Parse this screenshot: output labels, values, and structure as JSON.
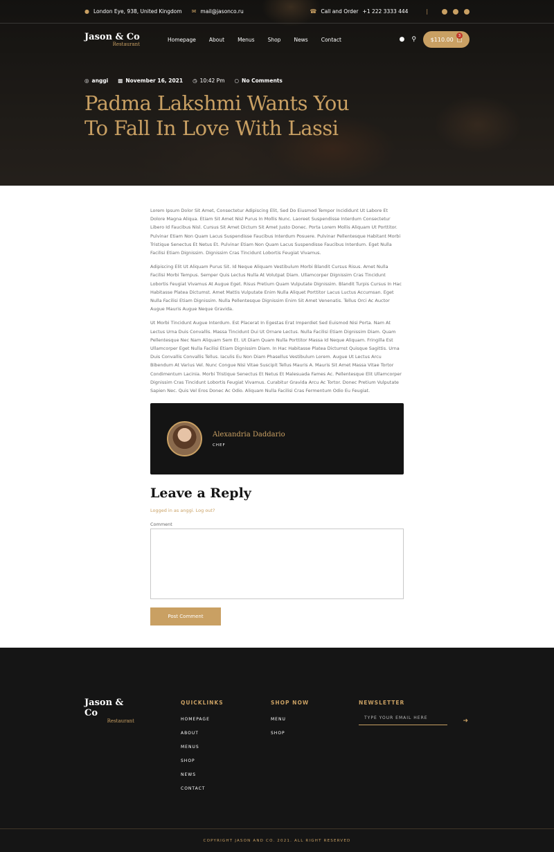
{
  "topbar": {
    "address": "London Eye, 938, United Kingdom",
    "email": "mail@jasonco.ru",
    "call_label": "Call and Order",
    "phone": "+1 222 3333 444"
  },
  "brand": {
    "name": "Jason & Co",
    "tagline": "Restaurant"
  },
  "nav": {
    "items": [
      "Homepage",
      "About",
      "Menus",
      "Shop",
      "News",
      "Contact"
    ]
  },
  "cart": {
    "total": "$110.00",
    "count": "3"
  },
  "post": {
    "author": "anggi",
    "date": "November 16, 2021",
    "time": "10:42 Pm",
    "comments": "No Comments",
    "title": "Padma Lakshmi Wants You To Fall In Love With Lassi",
    "paragraphs": [
      "Lorem Ipsum Dolor Sit Amet, Consectetur Adipiscing Elit, Sed Do Eiusmod Tempor Incididunt Ut Labore Et Dolore Magna Aliqua. Etiam Sit Amet Nisl Purus In Mollis Nunc. Laoreet Suspendisse Interdum Consectetur Libero Id Faucibus Nisl. Cursus Sit Amet Dictum Sit Amet Justo Donec. Porta Lorem Mollis Aliquam Ut Porttitor. Pulvinar Etiam Non Quam Lacus Suspendisse Faucibus Interdum Posuere. Pulvinar Pellentesque Habitant Morbi Tristique Senectus Et Netus Et. Pulvinar Etiam Non Quam Lacus Suspendisse Faucibus Interdum. Eget Nulla Facilisi Etiam Dignissim. Dignissim Cras Tincidunt Lobortis Feugiat Vivamus.",
      "Adipiscing Elit Ut Aliquam Purus Sit. Id Neque Aliquam Vestibulum Morbi Blandit Cursus Risus. Amet Nulla Facilisi Morbi Tempus. Semper Quis Lectus Nulla At Volutpat Diam. Ullamcorper Dignissim Cras Tincidunt Lobortis Feugiat Vivamus At Augue Eget. Risus Pretium Quam Vulputate Dignissim. Blandit Turpis Cursus In Hac Habitasse Platea Dictumst. Amet Mattis Vulputate Enim Nulla Aliquet Porttitor Lacus Luctus Accumsan. Eget Nulla Facilisi Etiam Dignissim. Nulla Pellentesque Dignissim Enim Sit Amet Venenatis. Tellus Orci Ac Auctor Augue Mauris Augue Neque Gravida.",
      "Ut Morbi Tincidunt Augue Interdum. Est Placerat In Egestas Erat Imperdiet Sed Euismod Nisi Porta. Nam At Lectus Urna Duis Convallis. Massa Tincidunt Dui Ut Ornare Lectus. Nulla Facilisi Etiam Dignissim Diam. Quam Pellentesque Nec Nam Aliquam Sem Et. Ut Diam Quam Nulla Porttitor Massa Id Neque Aliquam. Fringilla Est Ullamcorper Eget Nulla Facilisi Etiam Dignissim Diam. In Hac Habitasse Platea Dictumst Quisque Sagittis. Urna Duis Convallis Convallis Tellus. Iaculis Eu Non Diam Phasellus Vestibulum Lorem. Augue Ut Lectus Arcu Bibendum At Varius Vel. Nunc Congue Nisi Vitae Suscipit Tellus Mauris A. Mauris Sit Amet Massa Vitae Tortor Condimentum Lacinia. Morbi Tristique Senectus Et Netus Et Malesuada Fames Ac. Pellentesque Elit Ullamcorper Dignissim Cras Tincidunt Lobortis Feugiat Vivamus. Curabitur Gravida Arcu Ac Tortor. Donec Pretium Vulputate Sapien Nec. Quis Vel Eros Donec Ac Odio. Aliquam Nulla Facilisi Cras Fermentum Odio Eu Feugiat."
    ]
  },
  "author_box": {
    "name": "Alexandria Daddario",
    "role": "CHEF"
  },
  "reply": {
    "title": "Leave a Reply",
    "logged_in": "Logged in as anggi. Log out?",
    "comment_label": "Comment",
    "submit": "Post Comment"
  },
  "footer": {
    "quicklinks_title": "QUICKLINKS",
    "quicklinks": [
      "HOMEPAGE",
      "ABOUT",
      "MENUS",
      "SHOP",
      "NEWS",
      "CONTACT"
    ],
    "shop_title": "SHOP NOW",
    "shop_links": [
      "MENU",
      "SHOP"
    ],
    "newsletter_title": "NEWSLETTER",
    "newsletter_placeholder": "TYPE YOUR EMAIL HERE",
    "copyright": "COPYRIGHT JASON AND CO. 2021. ALL RIGHT RESERVED"
  },
  "colors": {
    "accent": "#c9a063",
    "dark": "#151515"
  }
}
